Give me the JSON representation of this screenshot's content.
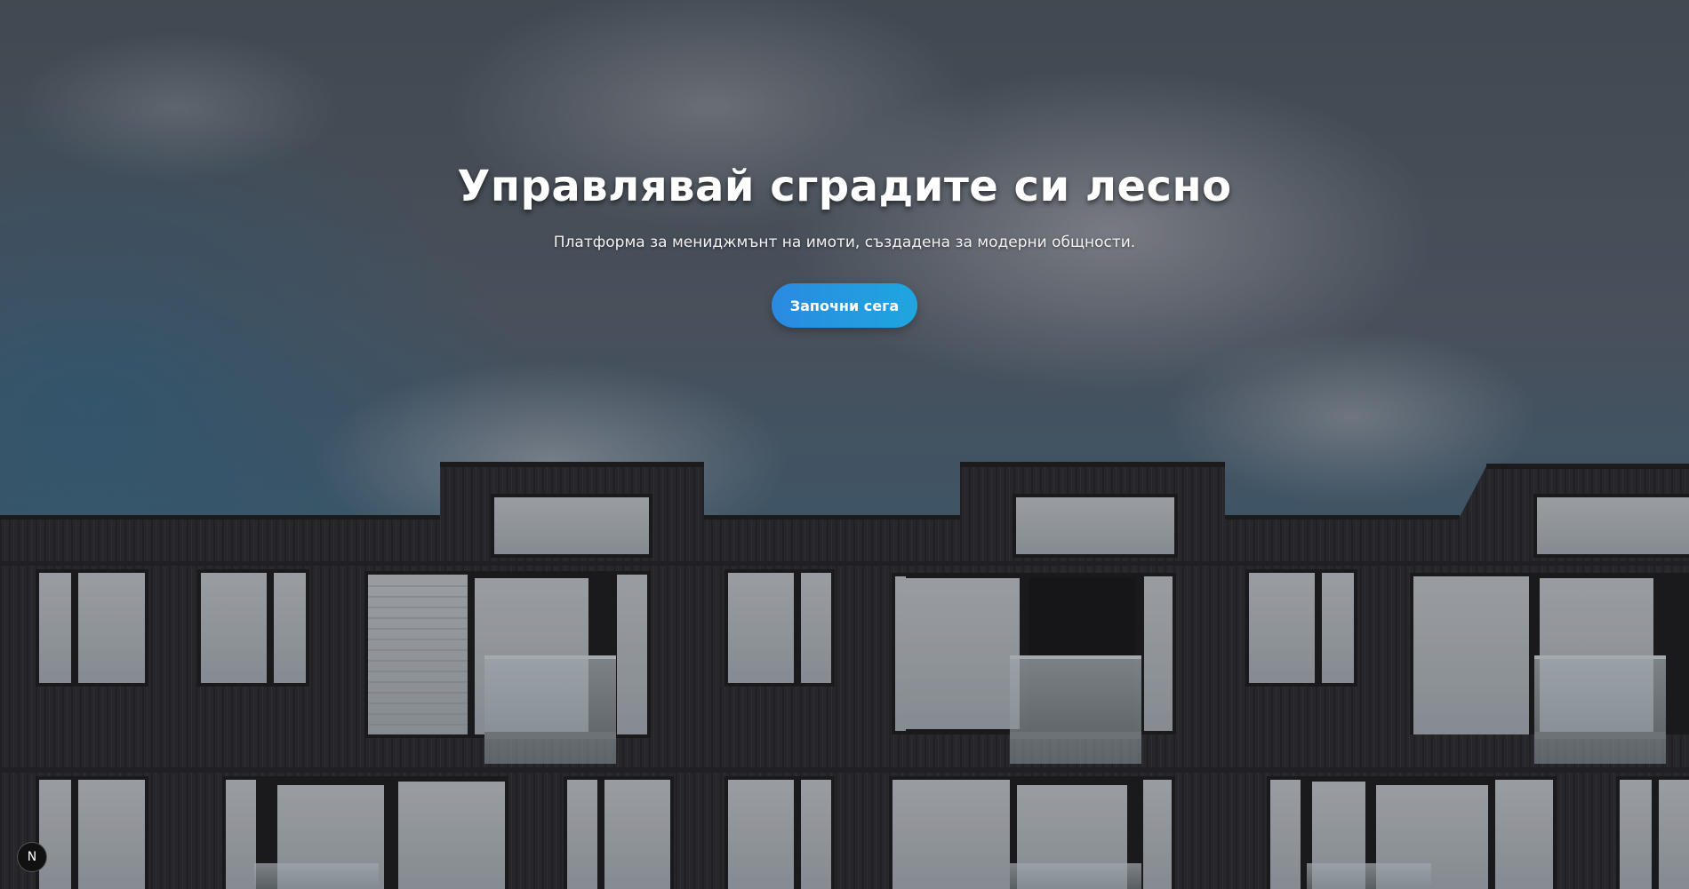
{
  "hero": {
    "title": "Управлявай сградите си лесно",
    "subtitle": "Платформа за мениджмънт на имоти, създадена за модерни общности.",
    "cta_label": "Започни сега"
  },
  "dev_badge": {
    "icon": "next-logo-icon",
    "letter": "N"
  },
  "colors": {
    "cta_start": "#2a8ae0",
    "cta_end": "#1fa6e0",
    "title_text": "#ffffff"
  }
}
